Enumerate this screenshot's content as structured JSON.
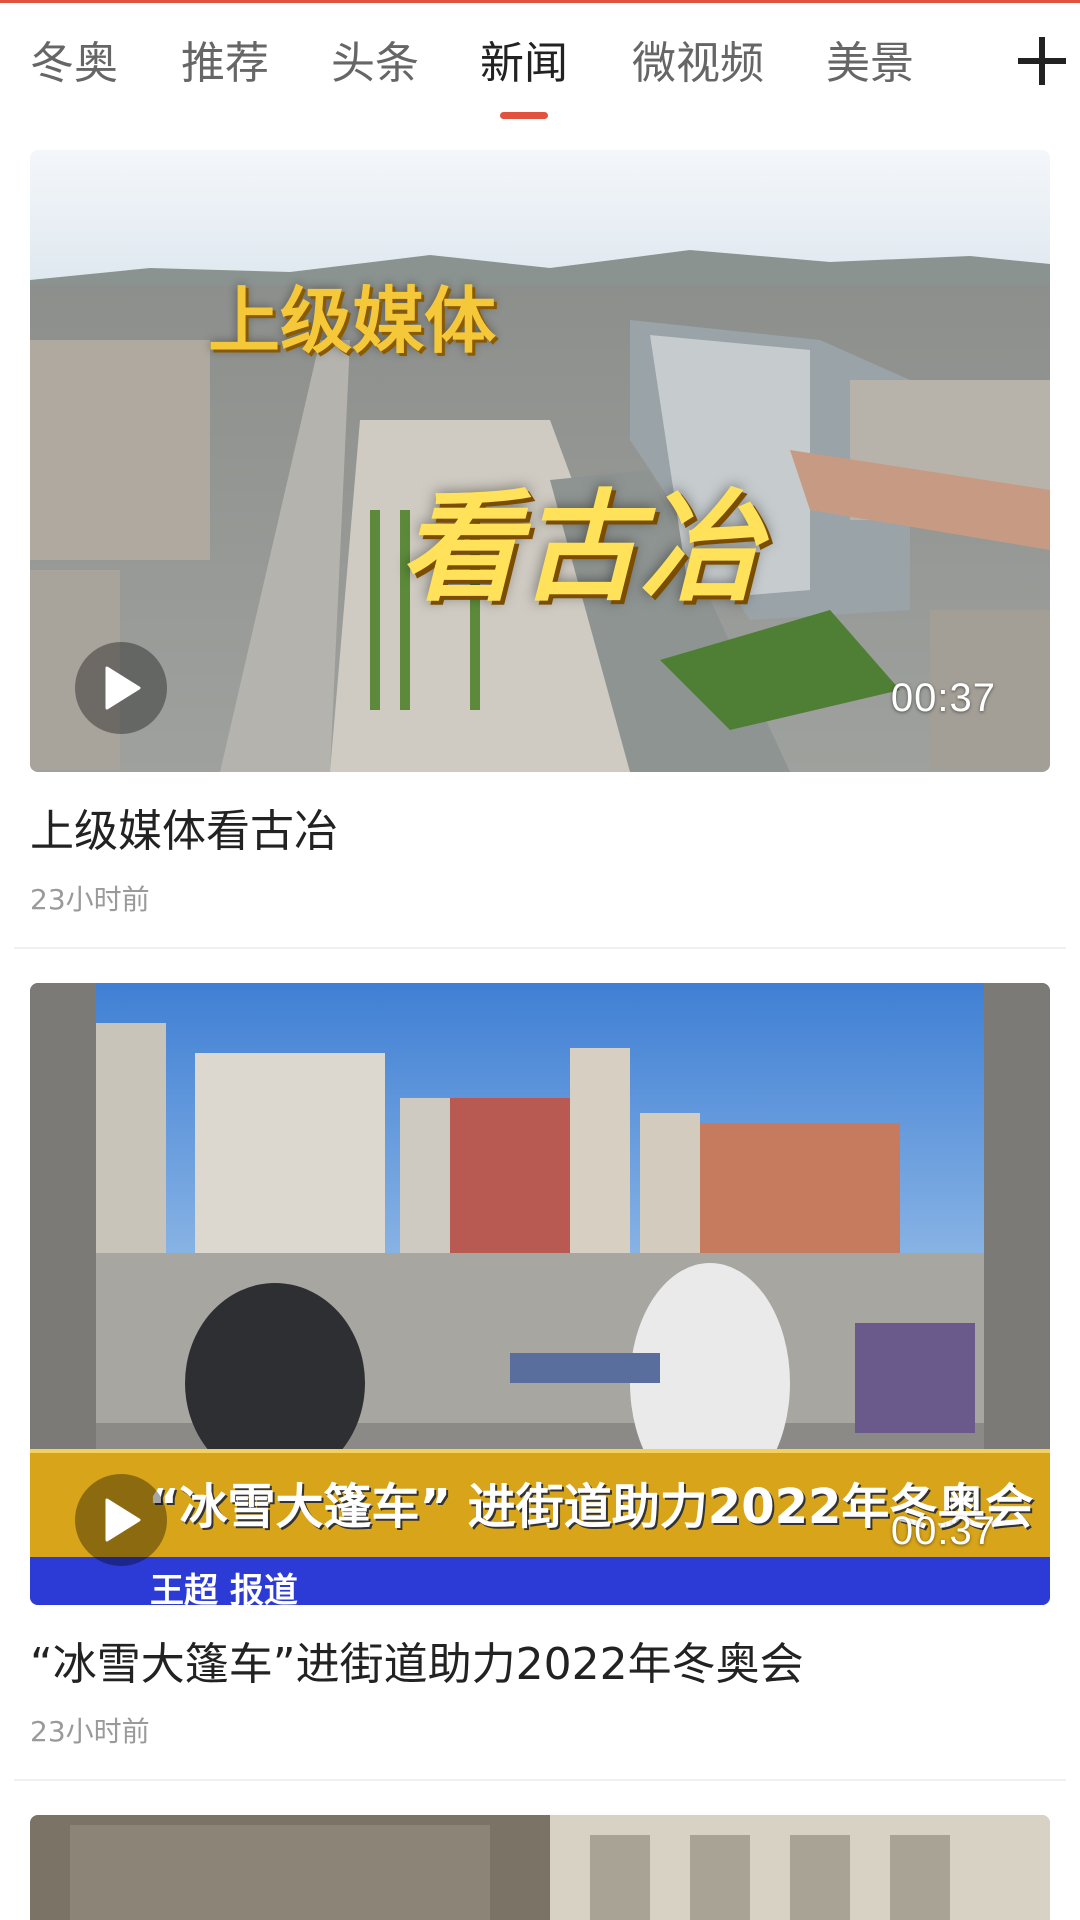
{
  "tabs": [
    {
      "label": "冬奥",
      "active": false
    },
    {
      "label": "推荐",
      "active": false
    },
    {
      "label": "头条",
      "active": false
    },
    {
      "label": "新闻",
      "active": true
    },
    {
      "label": "微视频",
      "active": false
    },
    {
      "label": "美景",
      "active": false
    }
  ],
  "add_tab_icon": "plus-icon",
  "accent_color": "#e2533f",
  "feed": [
    {
      "title": "上级媒体看古冶",
      "time": "23小时前",
      "duration": "00:37",
      "overlay_texts": [
        "上级媒体",
        "看古冶"
      ]
    },
    {
      "title": "“冰雪大篷车”进街道助力2022年冬奥会",
      "time": "23小时前",
      "duration": "00:37",
      "overlay_texts": [
        "“冰雪大篷车” 进街道助力2022年冬奥会",
        "王超 报道"
      ]
    }
  ]
}
